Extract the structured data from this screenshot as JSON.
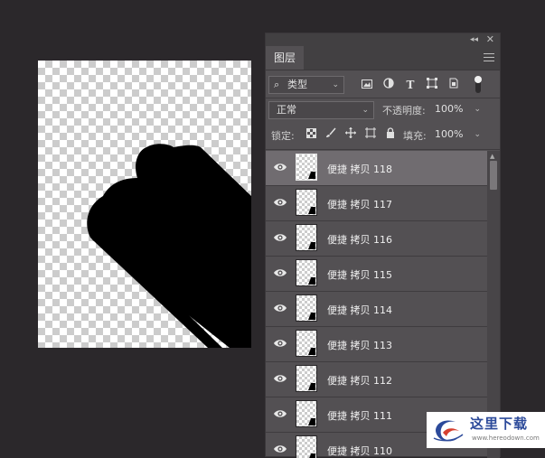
{
  "panel": {
    "tab_label": "图层",
    "collapse_glyph": "◂◂",
    "close_glyph": "✕"
  },
  "filter": {
    "search_glyph": "⌕",
    "kind_value": "类型",
    "icons": [
      "image-filter-icon",
      "adjustment-filter-icon",
      "type-filter-icon",
      "shape-filter-icon",
      "smart-object-filter-icon"
    ]
  },
  "blend": {
    "mode_value": "正常",
    "opacity_label": "不透明度:",
    "opacity_value": "100%"
  },
  "lock": {
    "label": "锁定:",
    "fill_label": "填充:",
    "fill_value": "100%"
  },
  "layers": [
    {
      "name": "便捷 拷贝 118",
      "selected": true
    },
    {
      "name": "便捷 拷贝 117",
      "selected": false
    },
    {
      "name": "便捷 拷贝 116",
      "selected": false
    },
    {
      "name": "便捷 拷贝 115",
      "selected": false
    },
    {
      "name": "便捷 拷贝 114",
      "selected": false
    },
    {
      "name": "便捷 拷贝 113",
      "selected": false
    },
    {
      "name": "便捷 拷贝 112",
      "selected": false
    },
    {
      "name": "便捷 拷贝 111",
      "selected": false
    },
    {
      "name": "便捷 拷贝 110",
      "selected": false
    }
  ],
  "watermark": {
    "title": "这里下载",
    "url": "www.hereodown.com"
  },
  "colors": {
    "app_bg": "#2b282b",
    "panel_bg": "#535053",
    "selected_row": "#706c70",
    "watermark_blue": "#2c4a9a"
  }
}
